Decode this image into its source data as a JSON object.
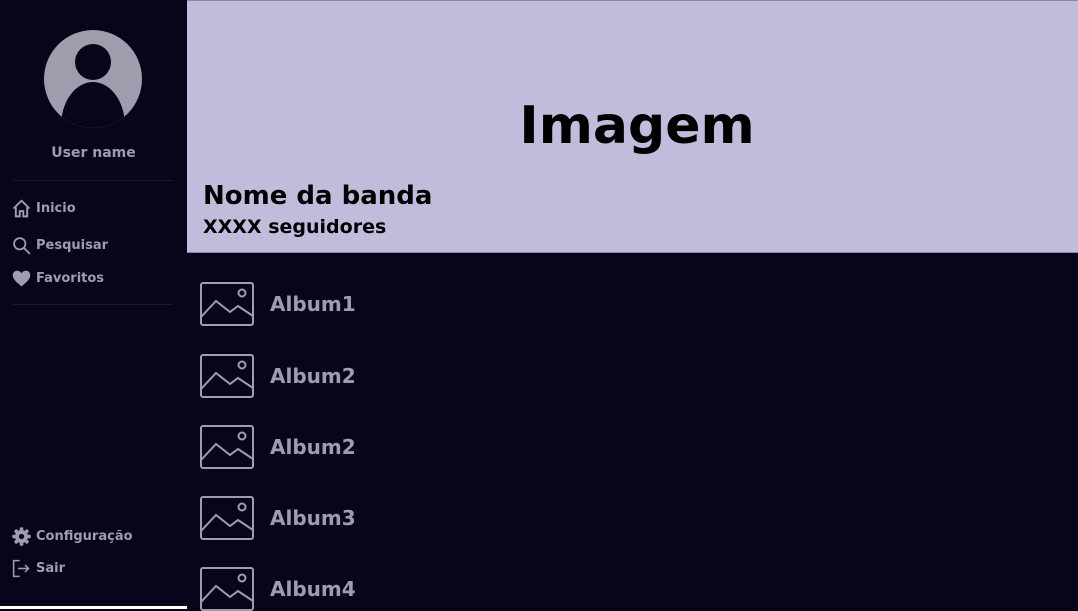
{
  "user": {
    "name": "User name"
  },
  "nav": {
    "items": [
      {
        "label": "Inicio",
        "icon": "home-icon"
      },
      {
        "label": "Pesquisar",
        "icon": "search-icon"
      },
      {
        "label": "Favoritos",
        "icon": "heart-icon"
      }
    ],
    "bottom": [
      {
        "label": "Configuração",
        "icon": "gear-icon"
      },
      {
        "label": "Sair",
        "icon": "logout-icon"
      }
    ]
  },
  "banner": {
    "image_text": "Imagem",
    "band_name": "Nome da banda",
    "followers": "XXXX seguidores"
  },
  "albums": [
    {
      "label": "Album1",
      "icon": "image-icon"
    },
    {
      "label": "Album2",
      "icon": "image-icon"
    },
    {
      "label": "Album2",
      "icon": "image-icon"
    },
    {
      "label": "Album3",
      "icon": "image-icon"
    },
    {
      "label": "Album4",
      "icon": "image-icon"
    }
  ],
  "colors": {
    "background": "#07051a",
    "banner": "#c1bcdb",
    "muted_text": "#9f9cae"
  }
}
